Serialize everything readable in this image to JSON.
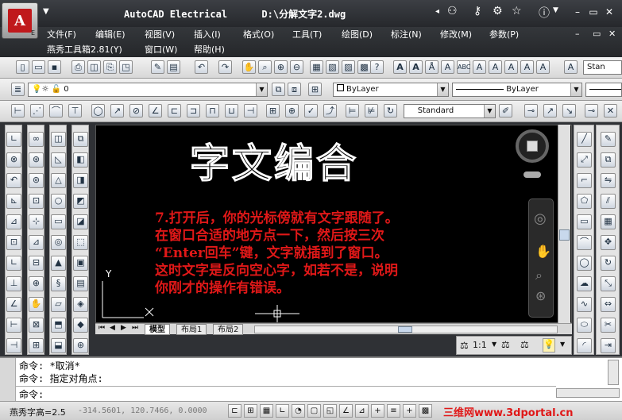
{
  "window": {
    "app_title": "AutoCAD Electrical",
    "file_path": "D:\\分解文字2.dwg",
    "app_letter": "A",
    "app_sub": "E"
  },
  "menu": {
    "items": [
      "文件(F)",
      "编辑(E)",
      "视图(V)",
      "插入(I)",
      "格式(O)",
      "工具(T)",
      "绘图(D)",
      "标注(N)",
      "修改(M)",
      "参数(P)"
    ],
    "sub_items": [
      "燕秀工具箱2.81(Y)",
      "窗口(W)",
      "帮助(H)"
    ]
  },
  "toolbar": {
    "layer_value": "0",
    "color_value": "ByLayer",
    "linetype_value": "ByLayer",
    "textstyle_value": "Standard",
    "style_right": "Stan"
  },
  "drawing": {
    "outline_title": "字文编合",
    "instructions": [
      "7.打开后，你的光标傍就有文字跟随了。",
      "在窗口合适的地方点一下，然后按三次",
      "“Enter回车”键，文字就插到了窗口。",
      "这时文字是反向空心字，如若不是，说明",
      "你刚才的操作有错误。"
    ],
    "ucs_y": "Y",
    "ucs_x": "X"
  },
  "tabs": [
    "模型",
    "布局1",
    "布局2"
  ],
  "annotation_scale": "1:1",
  "command": {
    "lines": [
      "命令: *取消*",
      "命令: 指定对角点:",
      "命令:"
    ]
  },
  "status": {
    "left_label": "燕秀字高=2.5",
    "coords": "-314.5601, 120.7466, 0.0000"
  },
  "watermark": "三维网www.3dportal.cn",
  "colors": {
    "accent_red": "#e01818",
    "canvas_bg": "#000000",
    "title_bg": "#2b2d31"
  }
}
